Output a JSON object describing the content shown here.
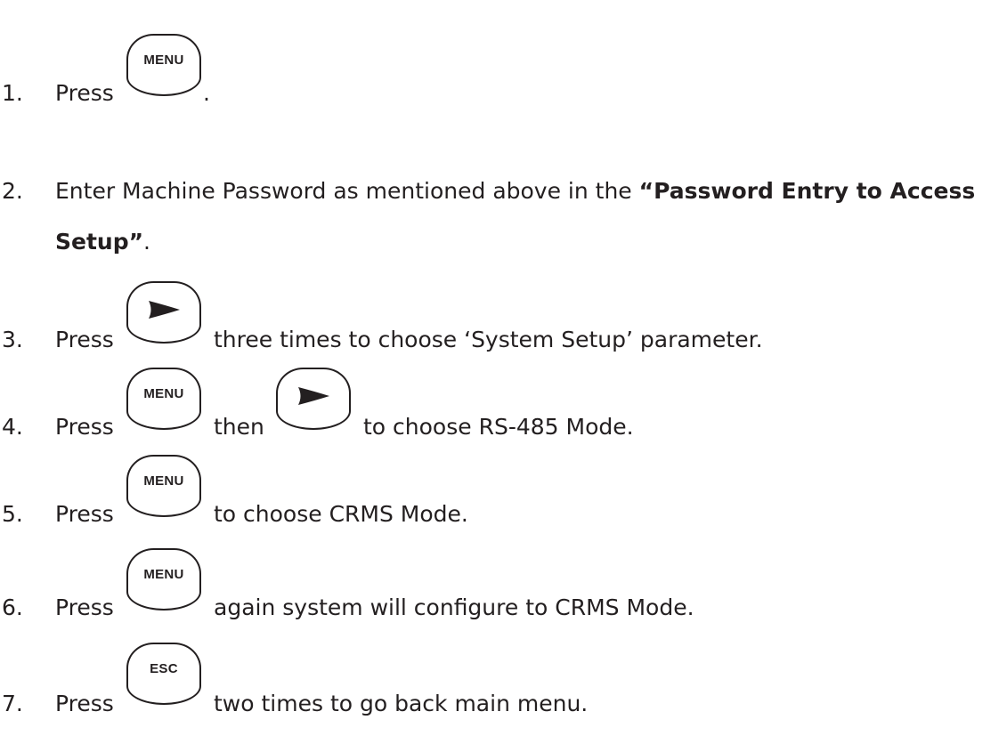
{
  "keys": {
    "menu": "MENU",
    "esc": "ESC",
    "right_icon": "right-arrow-icon"
  },
  "steps": [
    {
      "number": "1.",
      "before": "Press",
      "after": "."
    },
    {
      "number": "2.",
      "before": "Enter Machine Password as mentioned above in the ",
      "bold": "“Password Entry to Access",
      "bold2": "Setup”",
      "after": "."
    },
    {
      "number": "3.",
      "before": "Press",
      "after": "three times to choose ‘System Setup’ parameter."
    },
    {
      "number": "4.",
      "before": "Press",
      "middle": "then",
      "after": "to choose RS-485 Mode."
    },
    {
      "number": "5.",
      "before": "Press",
      "after": "to choose CRMS Mode."
    },
    {
      "number": "6.",
      "before": "Press",
      "after": "again system will configure to CRMS Mode."
    },
    {
      "number": "7.",
      "before": "Press",
      "after": "two times to go back main menu."
    }
  ]
}
